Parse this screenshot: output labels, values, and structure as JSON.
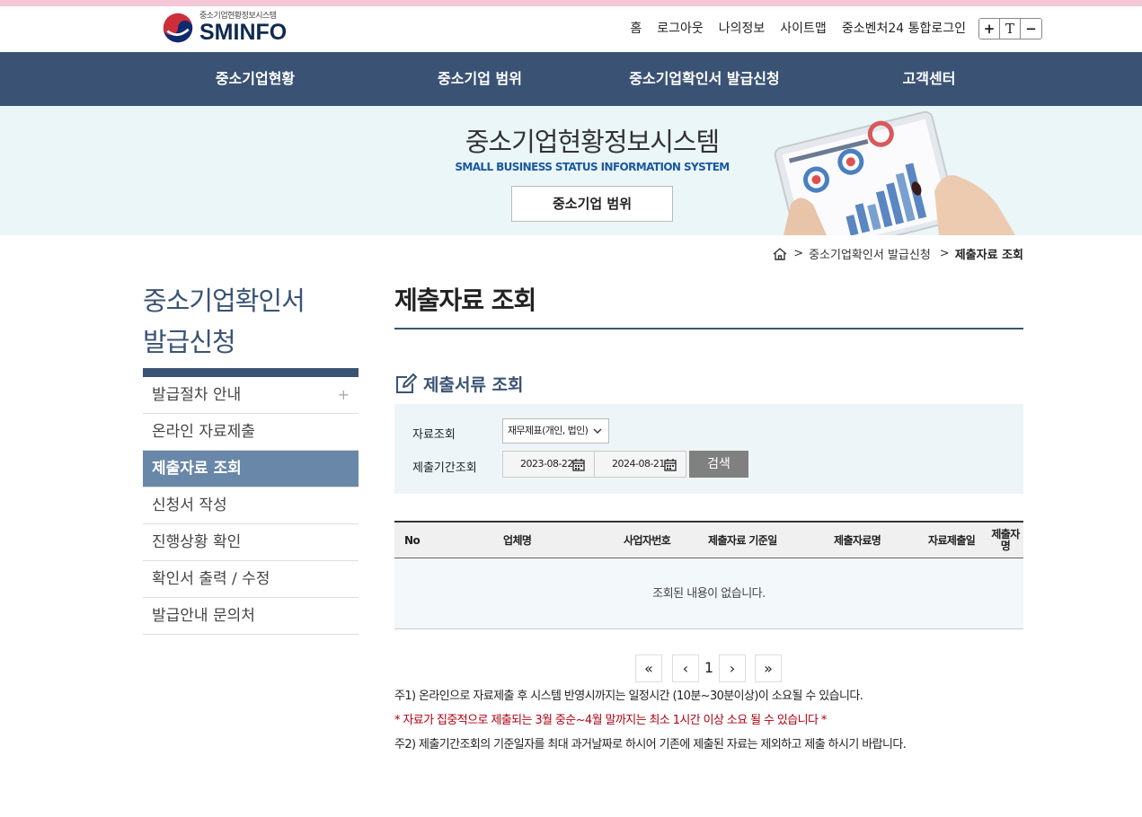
{
  "header": {
    "logo_small": "중소기업현황정보시스템",
    "logo_big": "SMINFO",
    "util": [
      "홈",
      "로그아웃",
      "나의정보",
      "사이트맵",
      "중소벤처24 통합로그인"
    ],
    "font_controls": [
      "+",
      "T",
      "−"
    ]
  },
  "gnb": [
    "중소기업현황",
    "중소기업 범위",
    "중소기업확인서 발급신청",
    "고객센터"
  ],
  "hero": {
    "title": "중소기업현황정보시스템",
    "subtitle": "SMALL BUSINESS STATUS INFORMATION SYSTEM",
    "button": "중소기업 범위"
  },
  "breadcrumb": [
    "중소기업확인서 발급신청",
    "제출자료 조회"
  ],
  "lnb": {
    "title_line1": "중소기업확인서",
    "title_line2": "발급신청",
    "items": [
      "발급절차 안내",
      "온라인 자료제출",
      "제출자료 조회",
      "신청서 작성",
      "진행상황 확인",
      "확인서 출력 / 수정",
      "발급안내 문의처"
    ],
    "active_index": 2,
    "plus": "+"
  },
  "content": {
    "title": "제출자료 조회",
    "section": "제출서류 조회"
  },
  "search": {
    "label_type": "자료조회",
    "select_value": "재무제표(개인, 법인)",
    "label_period": "제출기간조회",
    "date_from": "2023-08-22",
    "date_to": "2024-08-21",
    "button": "검색"
  },
  "table": {
    "headers": [
      "No",
      "업체명",
      "사업자번호",
      "제출자료 기준일",
      "제출자료명",
      "자료제출일"
    ],
    "last_header_1": "제출자",
    "last_header_2": "명",
    "empty": "조회된 내용이 없습니다."
  },
  "pager": {
    "first": "«",
    "prev": "‹",
    "current": "1",
    "next": "›",
    "last": "»"
  },
  "notes": {
    "n1": "주1) 온라인으로 자료제출 후 시스템 반영시까지는 일정시간 (10분~30분이상)이 소요될 수 있습니다.",
    "n2": "* 자료가 집중적으로 제출되는 3월 중순~4월 말까지는 최소 1시간 이상 소요 될 수 있습니다 *",
    "n3": "주2) 제출기간조회의 기준일자를 최대 과거날짜로 하시어 기존에 제출된 자료는 제외하고 제출 하시기 바랍니다."
  },
  "colors": {
    "nav": "#3a5374",
    "active": "#6987a8",
    "hero_bg": "#eaf6f8",
    "warning": "#b00010"
  }
}
